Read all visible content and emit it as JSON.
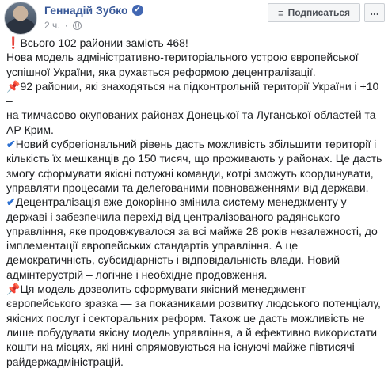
{
  "header": {
    "author": "Геннадій Зубко",
    "verified_icon": "verified-badge-icon",
    "time": "2 ч.",
    "privacy_icon": "globe-icon",
    "subscribe_label": "Подписаться",
    "subscribe_icon": "rss-icon",
    "more_label": "..."
  },
  "post": {
    "lines": [
      {
        "emoji": "❗",
        "emoji_name": "exclamation-icon",
        "text": "Всього 102 районии замість 468!"
      },
      {
        "emoji": "",
        "text": "Нова модель адміністративно-територіального устрою європейської"
      },
      {
        "emoji": "",
        "text": "успішної України, яка рухається реформою децентралізації."
      },
      {
        "emoji": "📌",
        "emoji_name": "pushpin-icon",
        "text": "92 районии, які знаходяться на підконтрольній території України і +10 –"
      },
      {
        "emoji": "",
        "text": "на тимчасово окупованих районах Донецької та Луганської областей та"
      },
      {
        "emoji": "",
        "text": "АР Крим."
      },
      {
        "emoji": "✔",
        "emoji_name": "check-icon",
        "text": "Новий субрегіональний рівень дасть можливість збільшити території і"
      },
      {
        "emoji": "",
        "text": "кількість їх мешканців до 150 тисяч, що проживають у районах. Це дасть"
      },
      {
        "emoji": "",
        "text": "змогу сформувати якісні потужні команди, котрі зможуть координувати,"
      },
      {
        "emoji": "",
        "text": "управляти процесами та делегованими повноваженнями від держави."
      },
      {
        "emoji": "✔",
        "emoji_name": "check-icon",
        "text": "Децентралізація вже докорінно змінила систему менеджменту у"
      },
      {
        "emoji": "",
        "text": "державі і забезпечила перехід від централізованого радянського"
      },
      {
        "emoji": "",
        "text": "управління, яке продовжувалося за всі майже 28 років незалежності, до"
      },
      {
        "emoji": "",
        "text": "імплементації європейських стандартів управління. А це"
      },
      {
        "emoji": "",
        "text": "демократичність, субсидіарність і відповідальність влади. Новий"
      },
      {
        "emoji": "",
        "text": "адмінтерустрій – логічне і необхідне продовження."
      },
      {
        "emoji": "📌",
        "emoji_name": "pushpin-icon",
        "text": "Ця модель дозволить сформувати якісний менеджмент"
      },
      {
        "emoji": "",
        "text": "європейського зразка — за показниками розвитку людського потенціалу,"
      },
      {
        "emoji": "",
        "text": "якісних послуг і секторальних реформ. Також це дасть можливість не"
      },
      {
        "emoji": "",
        "text": "лише побудувати якісну модель управління, а й ефективно використати"
      },
      {
        "emoji": "",
        "text": "кошти на місцях, які нині спрямовуються на існуючі майже півтисячі"
      },
      {
        "emoji": "",
        "text": "райдержадміністрацій."
      }
    ]
  },
  "colors": {
    "author": "#385898",
    "text": "#1c1e21",
    "meta": "#90949c",
    "button_bg": "#f5f6f7",
    "button_border": "#ccd0d5"
  }
}
